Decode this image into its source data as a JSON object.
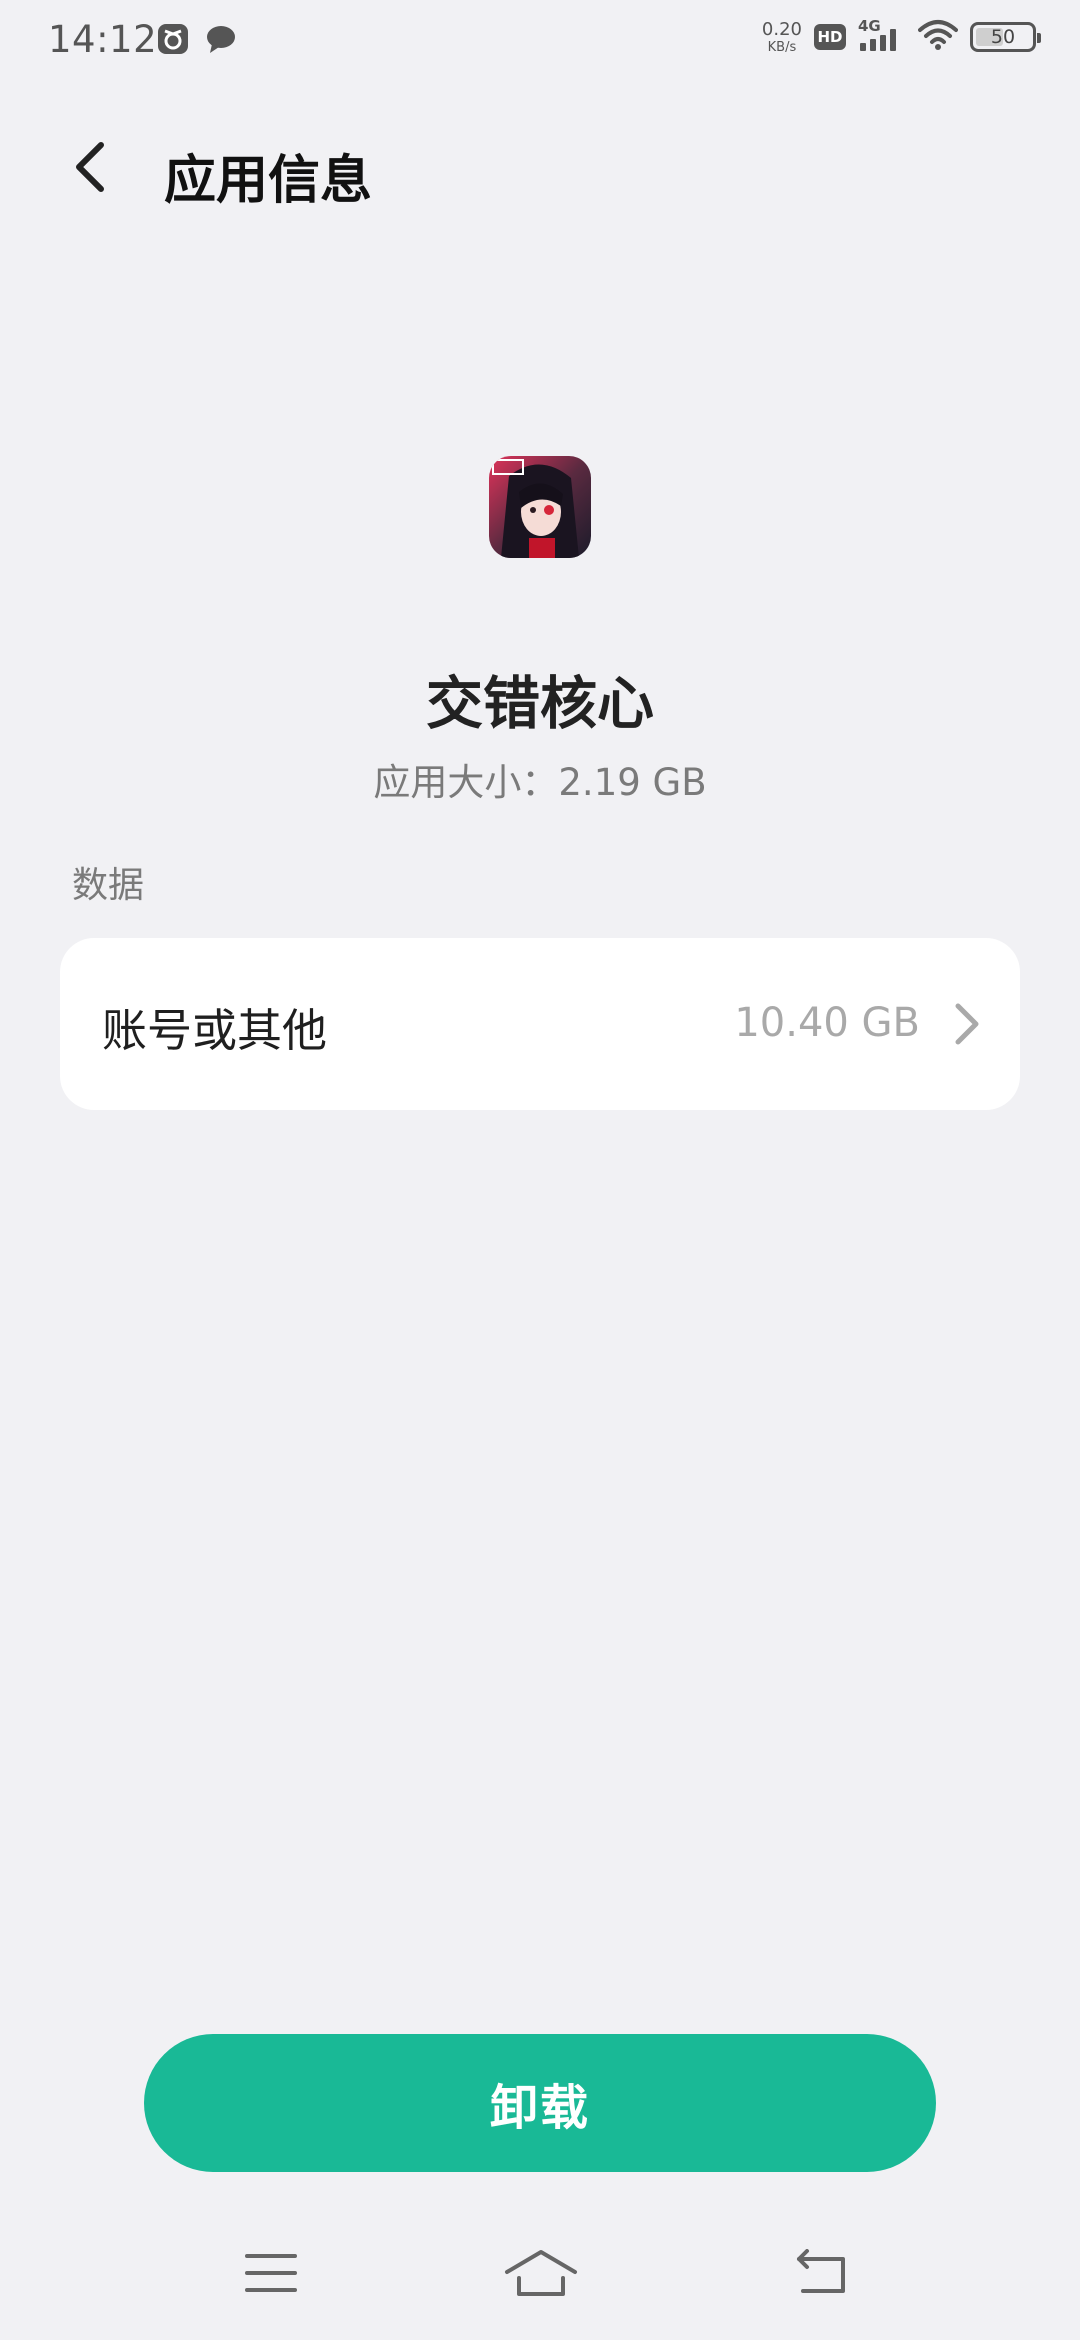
{
  "status_bar": {
    "time": "14:12",
    "left_icons": [
      "game-center-icon",
      "message-bubble-icon"
    ],
    "net_speed_value": "0.20",
    "net_speed_unit": "KB/s",
    "hd_label": "HD",
    "signal_label": "4G",
    "battery_level": "50",
    "battery_fraction": 0.5
  },
  "header": {
    "back_icon": "chevron-left-icon",
    "title": "应用信息"
  },
  "app": {
    "name": "交错核心",
    "size_text": "应用大小：2.19 GB"
  },
  "data_section": {
    "label": "数据",
    "item": {
      "title": "账号或其他",
      "value": "10.40 GB",
      "icon": "chevron-right-icon"
    }
  },
  "actions": {
    "uninstall_label": "卸载",
    "uninstall_color": "#19b996"
  },
  "nav_bar": {
    "icons": [
      "menu-icon",
      "home-icon",
      "back-icon"
    ]
  }
}
